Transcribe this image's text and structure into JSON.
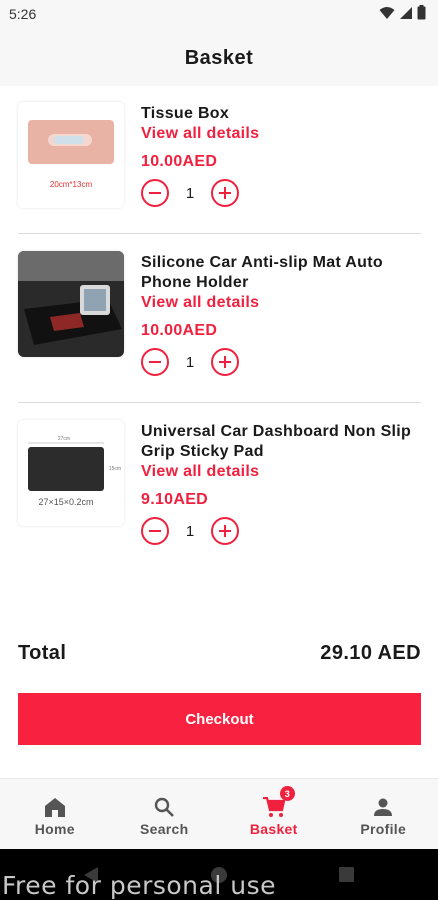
{
  "status_bar": {
    "time": "5:26",
    "icons": [
      "wifi-icon",
      "signal-icon",
      "battery-icon"
    ]
  },
  "header": {
    "title": "Basket"
  },
  "cart": {
    "items": [
      {
        "name": "Tissue Box",
        "details_link": "View all details",
        "price": "10.00AED",
        "quantity": "1",
        "image_caption": "20cm*13cm"
      },
      {
        "name": "Silicone Car Anti-slip Mat Auto Phone Holder",
        "details_link": "View all details",
        "price": "10.00AED",
        "quantity": "1"
      },
      {
        "name": "Universal Car Dashboard Non Slip Grip Sticky Pad",
        "details_link": "View all details",
        "price": "9.10AED",
        "quantity": "1",
        "image_caption": "27×15×0.2cm",
        "image_dim_top": "27cm",
        "image_dim_side": "15cm"
      }
    ]
  },
  "summary": {
    "total_label": "Total",
    "total_value": "29.10 AED"
  },
  "checkout": {
    "label": "Checkout"
  },
  "bottom_nav": {
    "items": [
      {
        "label": "Home",
        "icon": "home-icon"
      },
      {
        "label": "Search",
        "icon": "search-icon"
      },
      {
        "label": "Basket",
        "icon": "cart-icon",
        "badge": "3",
        "active": true
      },
      {
        "label": "Profile",
        "icon": "person-icon"
      }
    ]
  },
  "watermark": "Free for personal use",
  "colors": {
    "accent": "#f0213f",
    "checkout_bg": "#f8213f",
    "header_bg": "#f7f7f7",
    "text": "#1a1a1a"
  }
}
